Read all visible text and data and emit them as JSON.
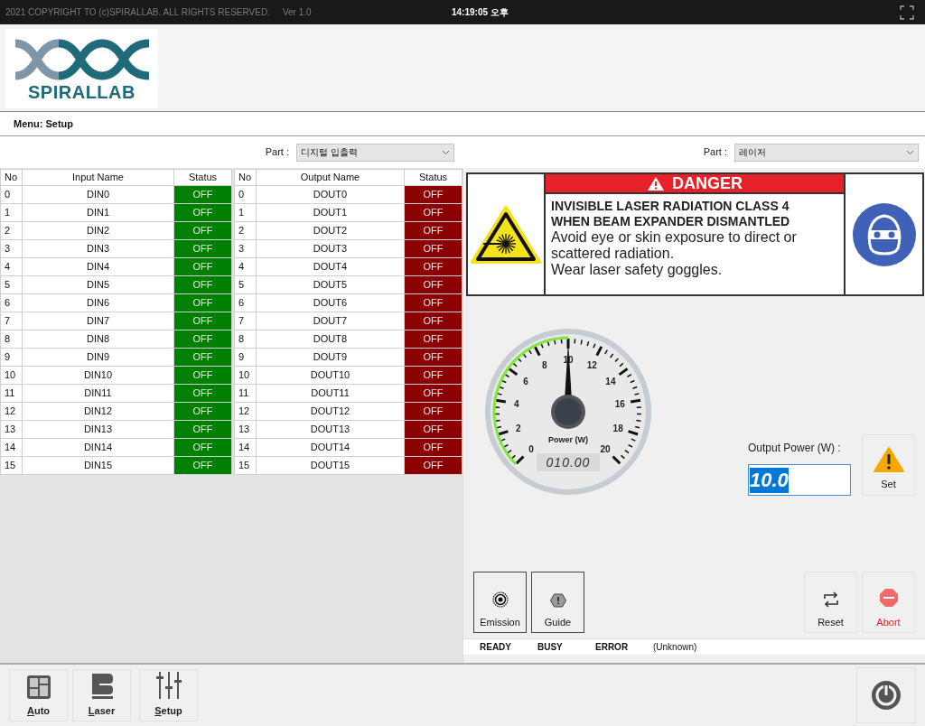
{
  "top_bar": {
    "copyright": "2021 COPYRIGHT TO (c)SPIRALLAB. ALL RIGHTS RESERVED.",
    "version": "Ver 1.0",
    "time": "14:19:05 오후"
  },
  "logo": {
    "text": "SPIRALLAB"
  },
  "menu": {
    "label": "Menu: Setup"
  },
  "io_panel": {
    "part_label": "Part :",
    "part_value": "디지털 입출력",
    "inputs": {
      "columns": [
        "No",
        "Input Name",
        "Status"
      ],
      "rows": [
        {
          "no": "0",
          "name": "DIN0",
          "status": "OFF"
        },
        {
          "no": "1",
          "name": "DIN1",
          "status": "OFF"
        },
        {
          "no": "2",
          "name": "DIN2",
          "status": "OFF"
        },
        {
          "no": "3",
          "name": "DIN3",
          "status": "OFF"
        },
        {
          "no": "4",
          "name": "DIN4",
          "status": "OFF"
        },
        {
          "no": "5",
          "name": "DIN5",
          "status": "OFF"
        },
        {
          "no": "6",
          "name": "DIN6",
          "status": "OFF"
        },
        {
          "no": "7",
          "name": "DIN7",
          "status": "OFF"
        },
        {
          "no": "8",
          "name": "DIN8",
          "status": "OFF"
        },
        {
          "no": "9",
          "name": "DIN9",
          "status": "OFF"
        },
        {
          "no": "10",
          "name": "DIN10",
          "status": "OFF"
        },
        {
          "no": "11",
          "name": "DIN11",
          "status": "OFF"
        },
        {
          "no": "12",
          "name": "DIN12",
          "status": "OFF"
        },
        {
          "no": "13",
          "name": "DIN13",
          "status": "OFF"
        },
        {
          "no": "14",
          "name": "DIN14",
          "status": "OFF"
        },
        {
          "no": "15",
          "name": "DIN15",
          "status": "OFF"
        }
      ]
    },
    "outputs": {
      "columns": [
        "No",
        "Output Name",
        "Status"
      ],
      "rows": [
        {
          "no": "0",
          "name": "DOUT0",
          "status": "OFF"
        },
        {
          "no": "1",
          "name": "DOUT1",
          "status": "OFF"
        },
        {
          "no": "2",
          "name": "DOUT2",
          "status": "OFF"
        },
        {
          "no": "3",
          "name": "DOUT3",
          "status": "OFF"
        },
        {
          "no": "4",
          "name": "DOUT4",
          "status": "OFF"
        },
        {
          "no": "5",
          "name": "DOUT5",
          "status": "OFF"
        },
        {
          "no": "6",
          "name": "DOUT6",
          "status": "OFF"
        },
        {
          "no": "7",
          "name": "DOUT7",
          "status": "OFF"
        },
        {
          "no": "8",
          "name": "DOUT8",
          "status": "OFF"
        },
        {
          "no": "9",
          "name": "DOUT9",
          "status": "OFF"
        },
        {
          "no": "10",
          "name": "DOUT10",
          "status": "OFF"
        },
        {
          "no": "11",
          "name": "DOUT11",
          "status": "OFF"
        },
        {
          "no": "12",
          "name": "DOUT12",
          "status": "OFF"
        },
        {
          "no": "13",
          "name": "DOUT13",
          "status": "OFF"
        },
        {
          "no": "14",
          "name": "DOUT14",
          "status": "OFF"
        },
        {
          "no": "15",
          "name": "DOUT15",
          "status": "OFF"
        }
      ]
    }
  },
  "laser_panel": {
    "part_label": "Part :",
    "part_value": "레이저",
    "danger_sign": {
      "header": "DANGER",
      "title_lines": [
        "INVISIBLE LASER RADIATION CLASS 4",
        "WHEN BEAM EXPANDER DISMANTLED"
      ],
      "body_lines": [
        "Avoid eye or skin exposure to direct or scattered radiation.",
        "Wear laser safety goggles."
      ]
    },
    "gauge": {
      "label": "Power (W)",
      "tick_labels": [
        "0",
        "2",
        "4",
        "6",
        "8",
        "10",
        "12",
        "14",
        "16",
        "18",
        "20"
      ],
      "level": 0.5,
      "readout": "010.00"
    },
    "output_power": {
      "label": "Output Power (W) :",
      "value": "10.0",
      "set_button": "Set"
    },
    "left_buttons": [
      {
        "label": "Emission",
        "kind": "emission"
      },
      {
        "label": "Guide",
        "kind": "guide"
      }
    ],
    "right_buttons": [
      {
        "label": "Reset",
        "kind": "reset"
      },
      {
        "label": "Abort",
        "kind": "abort"
      }
    ],
    "status_strip": [
      "READY",
      "BUSY",
      "ERROR",
      "(Unknown)"
    ]
  },
  "nav": [
    {
      "label": "Auto",
      "kind": "auto"
    },
    {
      "label": "Laser",
      "kind": "laser"
    },
    {
      "label": "Setup",
      "kind": "setup"
    }
  ]
}
